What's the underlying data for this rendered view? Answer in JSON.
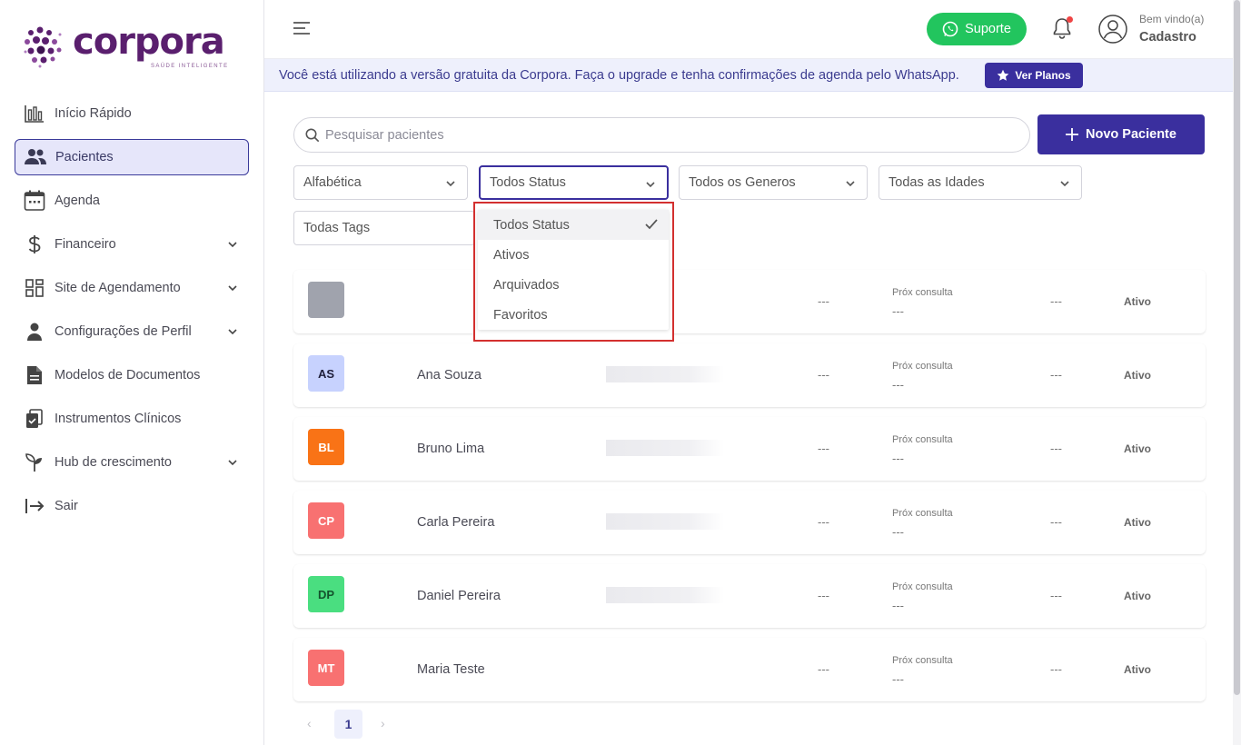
{
  "brand": {
    "name": "corpora",
    "tagline": "SAÚDE INTELIGENTE",
    "color": "#5a1f6e"
  },
  "sidebar": {
    "items": [
      {
        "label": "Início Rápido",
        "icon": "bar-chart-icon"
      },
      {
        "label": "Pacientes",
        "icon": "users-icon",
        "active": true
      },
      {
        "label": "Agenda",
        "icon": "calendar-icon"
      },
      {
        "label": "Financeiro",
        "icon": "dollar-icon",
        "expandable": true
      },
      {
        "label": "Site de Agendamento",
        "icon": "grid-icon",
        "expandable": true
      },
      {
        "label": "Configurações de Perfil",
        "icon": "user-icon",
        "expandable": true
      },
      {
        "label": "Modelos de Documentos",
        "icon": "document-icon"
      },
      {
        "label": "Instrumentos Clínicos",
        "icon": "clipboard-icon"
      },
      {
        "label": "Hub de crescimento",
        "icon": "sprout-icon",
        "expandable": true
      },
      {
        "label": "Sair",
        "icon": "logout-icon"
      }
    ]
  },
  "topbar": {
    "support_label": "Suporte",
    "welcome": "Bem vindo(a)",
    "username": "Cadastro"
  },
  "banner": {
    "text": "Você está utilizando a versão gratuita da Corpora. Faça o upgrade e tenha confirmações de agenda pelo WhatsApp.",
    "button_label": "Ver Planos"
  },
  "search": {
    "placeholder": "Pesquisar pacientes"
  },
  "actions": {
    "new_patient_label": "Novo Paciente"
  },
  "filters": {
    "order": "Alfabética",
    "status": "Todos Status",
    "gender": "Todos os Generos",
    "age": "Todas as Idades",
    "tags": "Todas Tags"
  },
  "status_dropdown": {
    "options": [
      "Todos Status",
      "Ativos",
      "Arquivados",
      "Favoritos"
    ],
    "selected": "Todos Status"
  },
  "patients": [
    {
      "initials": "",
      "name": "",
      "col1": "---",
      "next_label": "Próx consulta",
      "next_value": "---",
      "col2": "---",
      "status": "Ativo",
      "color": "#a0a3ad",
      "text_color": "#ffffff"
    },
    {
      "initials": "AS",
      "name": "Ana Souza",
      "col1": "---",
      "next_label": "Próx consulta",
      "next_value": "---",
      "col2": "---",
      "status": "Ativo",
      "color": "#c7d2fe",
      "text_color": "#1e1e3a"
    },
    {
      "initials": "BL",
      "name": "Bruno Lima",
      "col1": "---",
      "next_label": "Próx consulta",
      "next_value": "---",
      "col2": "---",
      "status": "Ativo",
      "color": "#f97316",
      "text_color": "#ffffff"
    },
    {
      "initials": "CP",
      "name": "Carla Pereira",
      "col1": "---",
      "next_label": "Próx consulta",
      "next_value": "---",
      "col2": "---",
      "status": "Ativo",
      "color": "#f87171",
      "text_color": "#ffffff"
    },
    {
      "initials": "DP",
      "name": "Daniel Pereira",
      "col1": "---",
      "next_label": "Próx consulta",
      "next_value": "---",
      "col2": "---",
      "status": "Ativo",
      "color": "#4ade80",
      "text_color": "#14532d"
    },
    {
      "initials": "MT",
      "name": "Maria Teste",
      "col1": "---",
      "next_label": "Próx consulta",
      "next_value": "---",
      "col2": "---",
      "status": "Ativo",
      "color": "#f87171",
      "text_color": "#ffffff"
    }
  ],
  "pagination": {
    "prev": "‹",
    "current": "1",
    "next": "›"
  },
  "colors": {
    "primary": "#3a2f9e",
    "support_green": "#22c55e",
    "highlight_red": "#d3302f"
  }
}
